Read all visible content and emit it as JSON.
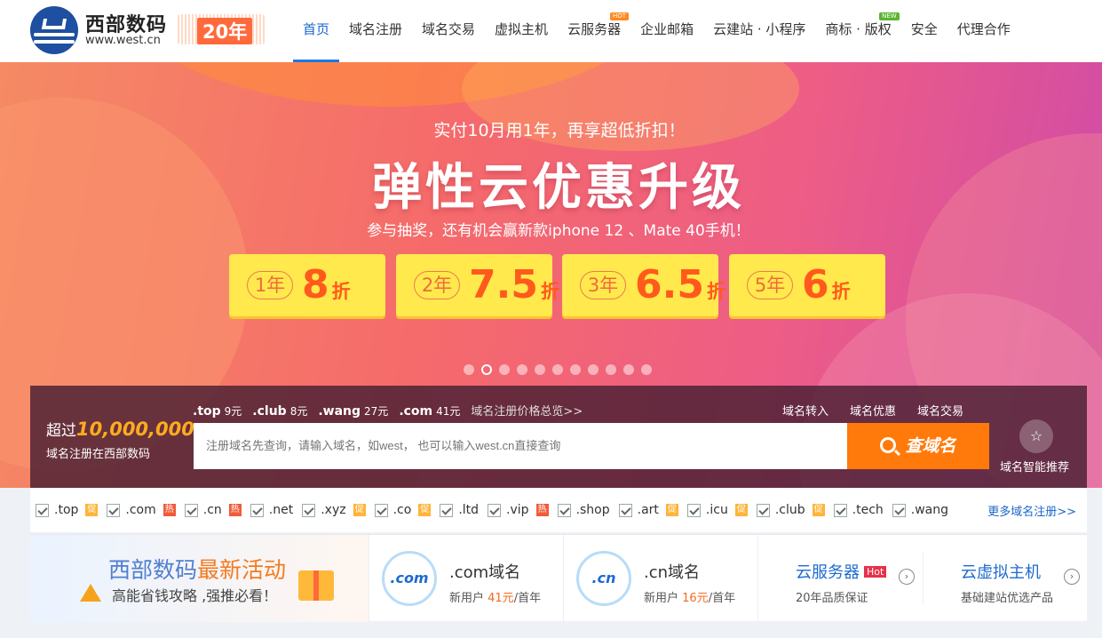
{
  "header": {
    "logo_name": "西部数码",
    "logo_url": "www.west.cn",
    "badge": "20年",
    "nav": [
      {
        "label": "首页",
        "active": true
      },
      {
        "label": "域名注册"
      },
      {
        "label": "域名交易"
      },
      {
        "label": "虚拟主机"
      },
      {
        "label": "云服务器",
        "tag": "HOT"
      },
      {
        "label": "企业邮箱"
      },
      {
        "label": "云建站 · 小程序"
      },
      {
        "label": "商标 · 版权",
        "tag": "NEW"
      },
      {
        "label": "安全"
      },
      {
        "label": "代理合作"
      }
    ]
  },
  "banner": {
    "subtitle": "实付10月用1年，再享超低折扣！",
    "title": "弹性云优惠升级",
    "desc": "参与抽奖，还有机会赢新款iphone 12 、Mate 40手机！",
    "coupons": [
      {
        "year": "1年",
        "rate": "8",
        "unit": "折"
      },
      {
        "year": "2年",
        "rate": "7.5",
        "unit": "折"
      },
      {
        "year": "3年",
        "rate": "6.5",
        "unit": "折"
      },
      {
        "year": "5年",
        "rate": "6",
        "unit": "折"
      }
    ],
    "slides_total": 11,
    "slide_active": 2
  },
  "search": {
    "over_prefix": "超过",
    "over_count": "10,000,000",
    "under": "域名注册在西部数码",
    "prices": [
      {
        "tld": ".top",
        "price": "9元"
      },
      {
        "tld": ".club",
        "price": "8元"
      },
      {
        "tld": ".wang",
        "price": "27元"
      },
      {
        "tld": ".com",
        "price": "41元"
      }
    ],
    "price_link": "域名注册价格总览>>",
    "links": [
      "域名转入",
      "域名优惠",
      "域名交易"
    ],
    "placeholder": "注册域名先查询，请输入域名，如west， 也可以输入west.cn直接查询",
    "button": "查域名",
    "ai_label": "域名智能推荐"
  },
  "tlds": [
    {
      "name": ".top",
      "tag": "促",
      "tagType": "cu"
    },
    {
      "name": ".com",
      "tag": "热",
      "tagType": "re"
    },
    {
      "name": ".cn",
      "tag": "热",
      "tagType": "re"
    },
    {
      "name": ".net"
    },
    {
      "name": ".xyz",
      "tag": "促",
      "tagType": "cu"
    },
    {
      "name": ".co",
      "tag": "促",
      "tagType": "cu"
    },
    {
      "name": ".ltd"
    },
    {
      "name": ".vip",
      "tag": "热",
      "tagType": "re"
    },
    {
      "name": ".shop"
    },
    {
      "name": ".art",
      "tag": "促",
      "tagType": "cu"
    },
    {
      "name": ".icu",
      "tag": "促",
      "tagType": "cu"
    },
    {
      "name": ".club",
      "tag": "促",
      "tagType": "cu"
    },
    {
      "name": ".tech"
    },
    {
      "name": ".wang"
    }
  ],
  "tld_more": "更多域名注册>>",
  "cards": {
    "activity": {
      "title_a": "西部数码",
      "title_b": "最新活动",
      "subtitle": "高能省钱攻略 ,强推必看！"
    },
    "com": {
      "icon": ".com",
      "name": ".com域名",
      "prefix": "新用户 ",
      "price": "41元",
      "suffix": "/首年"
    },
    "cn": {
      "icon": ".cn",
      "name": ".cn域名",
      "prefix": "新用户 ",
      "price": "16元",
      "suffix": "/首年"
    },
    "server": {
      "name": "云服务器",
      "hot": "Hot",
      "desc": "20年品质保证"
    },
    "vhost": {
      "name": "云虚拟主机",
      "desc": "基础建站优选产品"
    }
  },
  "colors": {
    "brand_blue": "#1e4fa0",
    "accent_orange": "#ff7a0a",
    "nav_active": "#1a66c9",
    "hot_red": "#e8304a"
  }
}
